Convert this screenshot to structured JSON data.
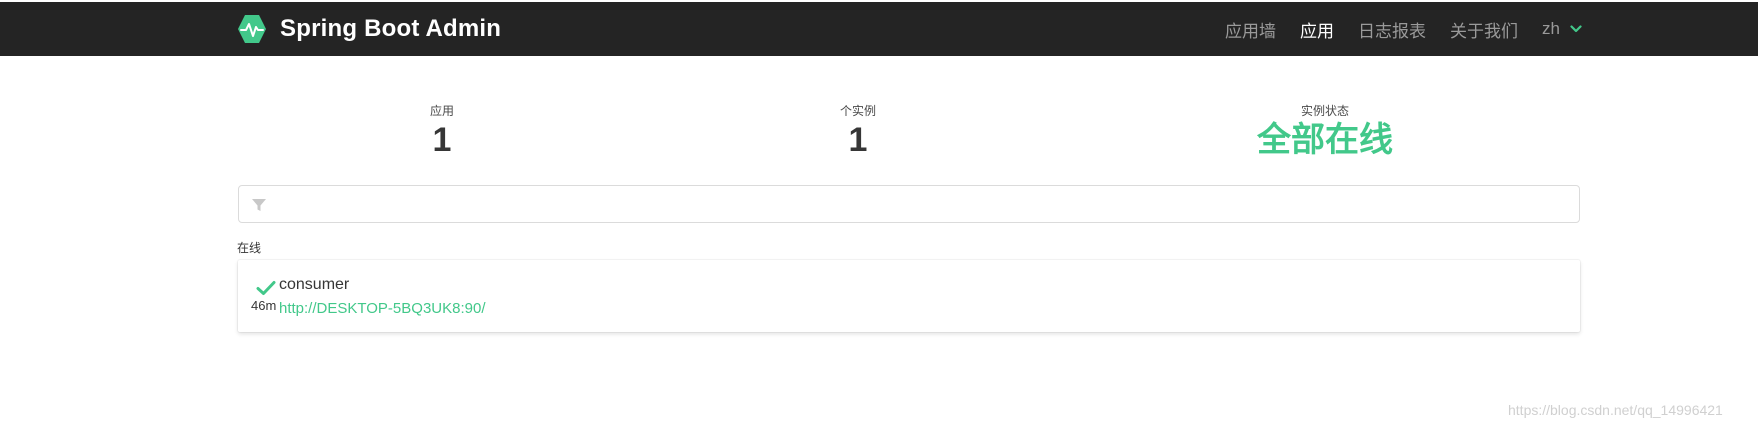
{
  "header": {
    "title": "Spring Boot Admin",
    "brand_color": "#42c88a",
    "nav": [
      {
        "label": "应用墙",
        "active": false
      },
      {
        "label": "应用",
        "active": true
      },
      {
        "label": "日志报表",
        "active": false
      },
      {
        "label": "关于我们",
        "active": false
      }
    ],
    "language": "zh"
  },
  "stats": {
    "applications": {
      "label": "应用",
      "value": "1"
    },
    "instances": {
      "label": "个实例",
      "value": "1"
    },
    "status": {
      "label": "实例状态",
      "value": "全部在线"
    }
  },
  "filter": {
    "placeholder": "",
    "icon": "filter-icon"
  },
  "groups": [
    {
      "title": "在线",
      "applications": [
        {
          "name": "consumer",
          "uptime": "46m",
          "url": "http://DESKTOP-5BQ3UK8:90/",
          "status": "UP",
          "status_icon": "check-icon"
        }
      ]
    }
  ],
  "watermark": "https://blog.csdn.net/qq_14996421"
}
